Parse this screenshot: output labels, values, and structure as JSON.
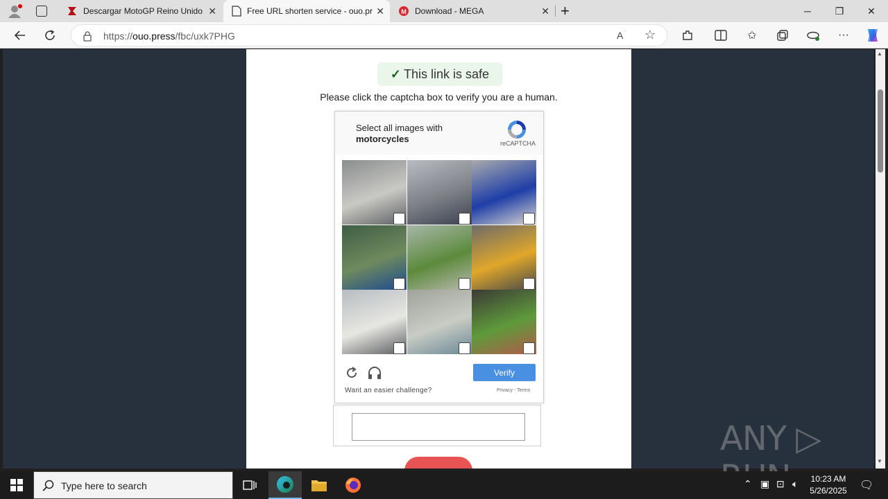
{
  "browser": {
    "tabs": [
      {
        "title": "Descargar MotoGP Reino Unido",
        "icon": "red-bolt-icon",
        "active": false
      },
      {
        "title": "Free URL shorten service - ouo.pr",
        "icon": "page-icon",
        "active": true
      },
      {
        "title": "Download - MEGA",
        "icon": "mega-icon",
        "active": false
      }
    ],
    "new_tab_label": "+",
    "url_prefix": "https://",
    "url_domain": "ouo.press",
    "url_path": "/fbc/uxk7PHG"
  },
  "page": {
    "safe_check": "✓",
    "safe_text": "This link is safe",
    "instruction": "Please click the captcha box to verify you are a human."
  },
  "captcha": {
    "prompt_line1": "Select all images with",
    "prompt_line2": "motorcycles",
    "brand": "reCAPTCHA",
    "verify_label": "Verify",
    "easier": "Want an easier challenge?",
    "privacy": "Privacy - Terms",
    "tiles": [
      {
        "name": "tile-overpass",
        "colors": [
          "#8a8d8f",
          "#c9c9c4",
          "#5e6064"
        ]
      },
      {
        "name": "tile-bike-riders",
        "colors": [
          "#b9bcc1",
          "#7d8087",
          "#3c4150"
        ]
      },
      {
        "name": "tile-blue-motorcycle",
        "colors": [
          "#a9aaad",
          "#1e3ea8",
          "#d9d5cf"
        ]
      },
      {
        "name": "tile-street-bus",
        "colors": [
          "#3f5e45",
          "#6e8a5e",
          "#1d4a8f"
        ]
      },
      {
        "name": "tile-highway-trees",
        "colors": [
          "#a7b7a8",
          "#5c8a3c",
          "#b8b8ad"
        ]
      },
      {
        "name": "tile-school-bus",
        "colors": [
          "#6d6b6a",
          "#e0a72a",
          "#4a4a48"
        ]
      },
      {
        "name": "tile-city-street",
        "colors": [
          "#b7bcc1",
          "#e7e7e2",
          "#5b5d60"
        ]
      },
      {
        "name": "tile-bridge",
        "colors": [
          "#9fa39a",
          "#c8ccc4",
          "#6c8896"
        ]
      },
      {
        "name": "tile-scooter-fruit",
        "colors": [
          "#3c3a36",
          "#5e9a3b",
          "#b45a4a"
        ]
      }
    ]
  },
  "watermark": "ANY ▷ RUN",
  "taskbar": {
    "search_placeholder": "Type here to search",
    "time": "10:23 AM",
    "date": "5/26/2025"
  },
  "colors": {
    "accent": "#4a90e2",
    "page_bg": "#27313e",
    "red_button": "#e85353"
  }
}
